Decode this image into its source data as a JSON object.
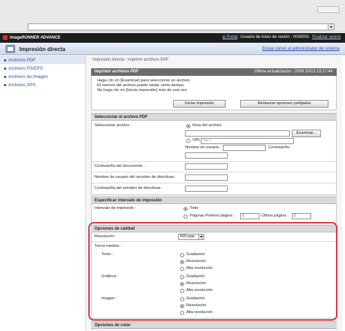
{
  "browser": {
    "address": ""
  },
  "header": {
    "product": "imageRUNNER ADVANCE",
    "portal_link": "al Portal",
    "user_label": "Usuario de inicio de sesión : 0000001",
    "logout_link": "Finalizar sesión"
  },
  "titlebar": {
    "title": "Impresión directa",
    "admin_link": "Enviar correo al administrador del sistema"
  },
  "sidebar": {
    "items": [
      {
        "label": "Archivos PDF"
      },
      {
        "label": "Archivos PS/EPS"
      },
      {
        "label": "Archivos de imagen"
      },
      {
        "label": "Archivos XPS"
      }
    ]
  },
  "main": {
    "breadcrumb": "Impresión directa : Imprimir archivos PDF",
    "print_section": {
      "title": "Imprimir archivos PDF",
      "last_update": "Última actualización : 2009 10/13 13:17:44",
      "instructions": [
        "Haga clic en [Examinar] para seleccionar un archivo.",
        "El reenvío del archivo puede tardar cierto tiempo.",
        "No haga clic en [Iniciar impresión] más de una vez."
      ],
      "start_button": "Iniciar impresión",
      "restore_button": "Restaurar opciones prefijadas"
    },
    "select_section": {
      "title": "Seleccionar el archivo PDF",
      "select_label": "Seleccionar archivo :",
      "path_option": "Ruta del archivo",
      "browse_button": "Examinar...",
      "url_option": "URL",
      "url_placeholder": "http://",
      "username_label": "Nombre de usuario :",
      "password_label": "Contraseña :",
      "doc_password_label": "Contraseña del documento :",
      "policy_user_label": "Nombre de usuario del servidor de directivas :",
      "policy_password_label": "Contraseña del servidor de directivas :"
    },
    "range_section": {
      "title": "Especificar intervalo de impresión",
      "label": "Intervalo de impresión :",
      "all_option": "Todo",
      "pages_option": "Páginas Primera página :",
      "first_page": "1",
      "last_label": "Última página :",
      "last_page": "1"
    },
    "quality_section": {
      "title": "Opciones de calidad",
      "resolution_label": "Resolución :",
      "resolution_value": "600 ppp",
      "halftones_label": "Tonos medios :",
      "groups": [
        {
          "label": "Texto :",
          "options": [
            "Gradación",
            "Resolución",
            "Alta resolución"
          ],
          "selected": 1
        },
        {
          "label": "Gráficos :",
          "options": [
            "Gradación",
            "Resolución",
            "Alta resolución"
          ],
          "selected": 1
        },
        {
          "label": "Imagen :",
          "options": [
            "Gradación",
            "Resolución",
            "Alta resolución"
          ],
          "selected": 1
        }
      ]
    },
    "color_section": {
      "title": "Opciones de color"
    }
  },
  "colors": {
    "highlight": "#d62f3c",
    "link": "#1f4e9c",
    "dark_header": "#6b6b6b"
  }
}
